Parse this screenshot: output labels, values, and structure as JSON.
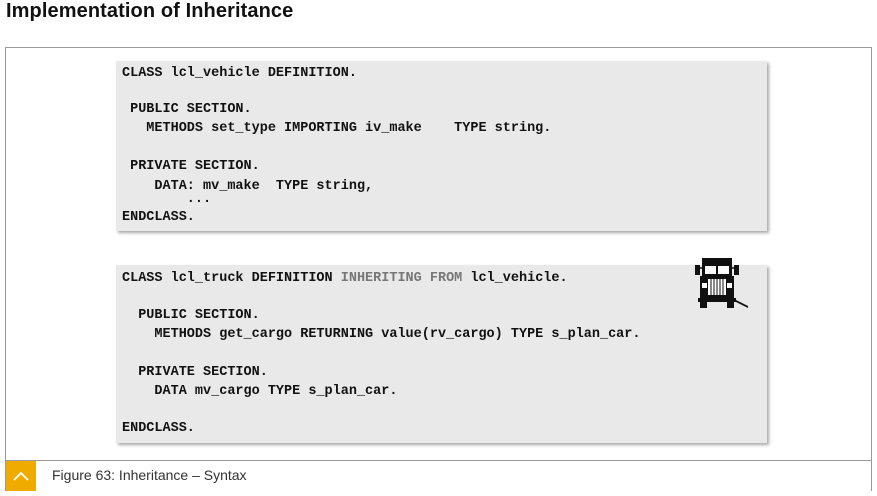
{
  "page": {
    "title": "Implementation of Inheritance"
  },
  "code_block_1": {
    "lines": [
      "CLASS lcl_vehicle DEFINITION.",
      " PUBLIC SECTION.",
      "   METHODS set_type IMPORTING iv_make    TYPE string.",
      " PRIVATE SECTION.",
      "    DATA: mv_make  TYPE string,",
      "        ...",
      "ENDCLASS."
    ]
  },
  "code_block_2": {
    "class_line": {
      "part1": "CLASS lcl_truck DEFINITION ",
      "inherit_kw": "INHERITING FROM",
      "part2": " lcl_vehicle."
    },
    "lines": [
      "  PUBLIC SECTION.",
      "    METHODS get_cargo RETURNING value(rv_cargo) TYPE s_plan_car.",
      "  PRIVATE SECTION.",
      "    DATA mv_cargo TYPE s_plan_car.",
      "ENDCLASS."
    ],
    "icon": "truck-icon"
  },
  "caption": {
    "text": "Figure 63: Inheritance – Syntax",
    "toggle_icon": "chevron-up-icon",
    "accent_color": "#f0ab00"
  }
}
